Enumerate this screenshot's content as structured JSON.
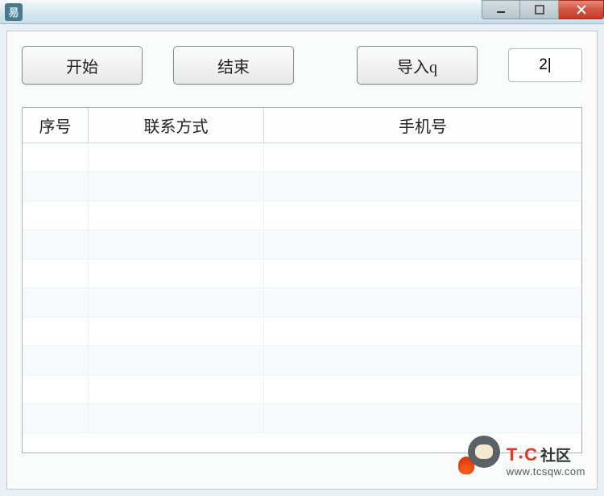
{
  "window": {
    "app_icon_text": "易"
  },
  "toolbar": {
    "start_label": "开始",
    "end_label": "结束",
    "import_label": "导入q",
    "input_value": "2|"
  },
  "table": {
    "headers": {
      "num": "序号",
      "contact": "联系方式",
      "phone": "手机号"
    },
    "rows": []
  },
  "watermark": {
    "brand_prefix": "T",
    "brand_suffix": "C",
    "brand_cn": "社区",
    "url": "www.tcsqw.com"
  }
}
